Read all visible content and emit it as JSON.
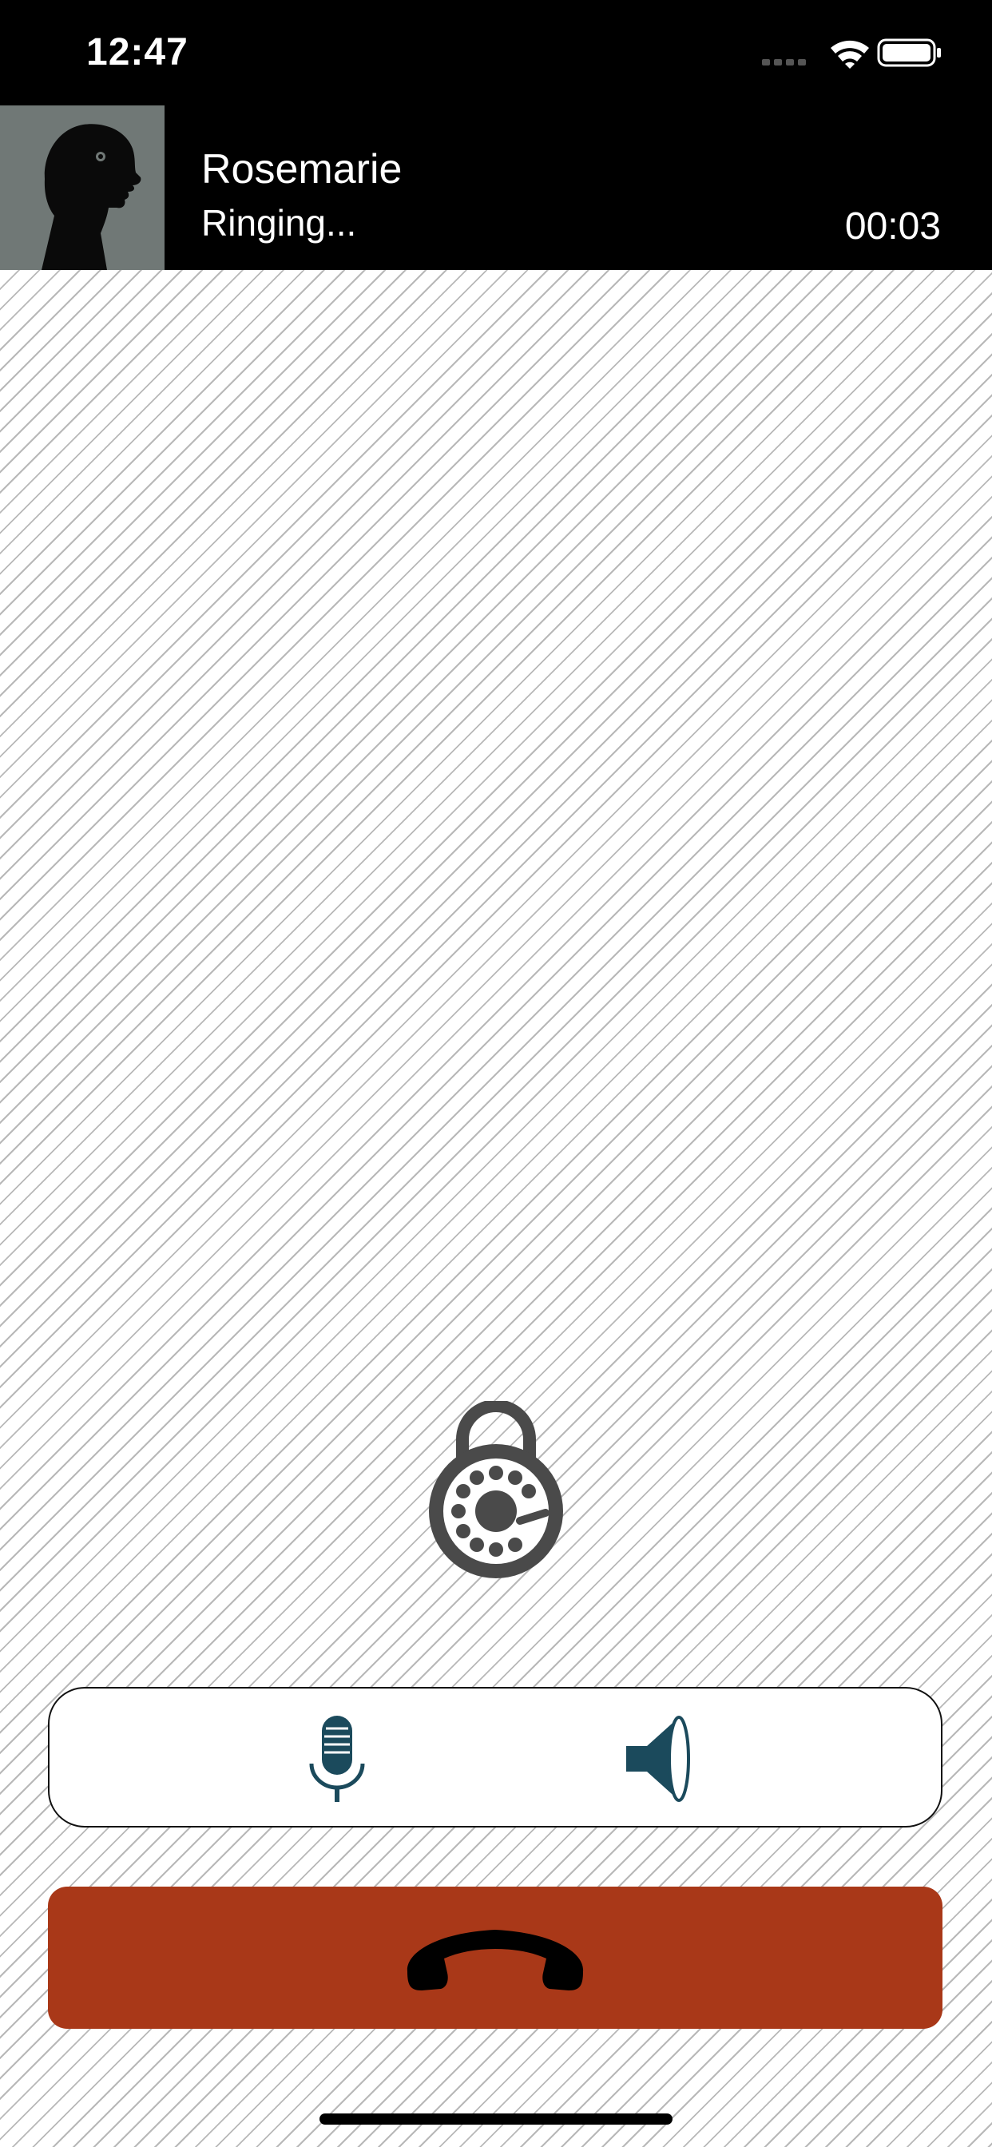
{
  "status_bar": {
    "time": "12:47"
  },
  "call": {
    "caller_name": "Rosemarie",
    "status": "Ringing...",
    "timer": "00:03"
  },
  "icons": {
    "avatar": "silhouette-avatar",
    "keypad": "rotary-dial-icon",
    "mute": "microphone-icon",
    "speaker": "speaker-icon",
    "end_call": "phone-hangup-icon"
  },
  "colors": {
    "header_background": "#000000",
    "avatar_background": "#707876",
    "end_call": "#a93818",
    "control_icon": "#1b4a5c",
    "stripe": "#b8b8b8"
  }
}
